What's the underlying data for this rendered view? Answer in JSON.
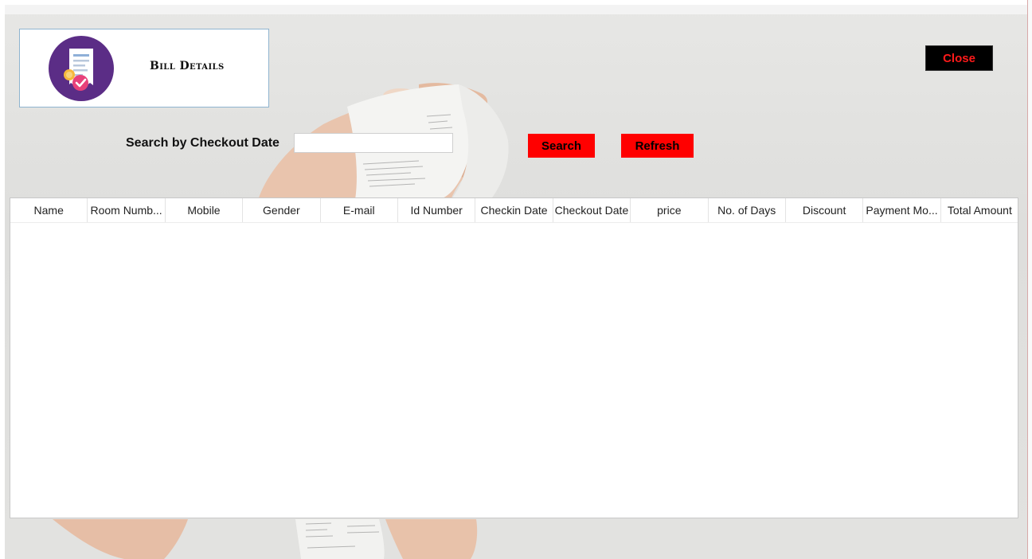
{
  "header": {
    "title": "Bill Details",
    "close_label": "Close"
  },
  "search": {
    "label": "Search by Checkout Date",
    "value": "",
    "placeholder": "",
    "search_label": "Search",
    "refresh_label": "Refresh"
  },
  "table": {
    "columns": [
      "Name",
      "Room Numb...",
      "Mobile",
      "Gender",
      "E-mail",
      "Id Number",
      "Checkin Date",
      "Checkout Date",
      "price",
      "No. of Days",
      "Discount",
      "Payment Mo...",
      "Total Amount"
    ],
    "rows": []
  },
  "icons": {
    "title": "receipt-payment-icon"
  },
  "colors": {
    "accent": "#ff0000",
    "close_bg": "#000000",
    "close_text": "#ff1a1a",
    "icon_circle": "#5b2d86"
  }
}
